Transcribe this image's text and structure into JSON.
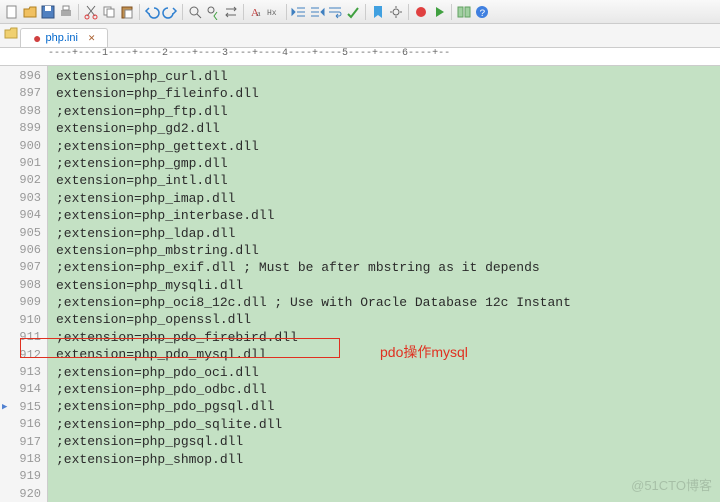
{
  "tab": {
    "filename": "php.ini"
  },
  "ruler_text": "----+----1----+----2----+----3----+----4----+----5----+----6----+--",
  "lines": [
    {
      "num": "896",
      "text": "extension=php_curl.dll"
    },
    {
      "num": "897",
      "text": "extension=php_fileinfo.dll"
    },
    {
      "num": "898",
      "text": ";extension=php_ftp.dll"
    },
    {
      "num": "899",
      "text": "extension=php_gd2.dll"
    },
    {
      "num": "900",
      "text": ";extension=php_gettext.dll"
    },
    {
      "num": "901",
      "text": ";extension=php_gmp.dll"
    },
    {
      "num": "902",
      "text": "extension=php_intl.dll"
    },
    {
      "num": "903",
      "text": ";extension=php_imap.dll"
    },
    {
      "num": "904",
      "text": ";extension=php_interbase.dll"
    },
    {
      "num": "905",
      "text": ";extension=php_ldap.dll"
    },
    {
      "num": "906",
      "text": "extension=php_mbstring.dll"
    },
    {
      "num": "907",
      "text": ";extension=php_exif.dll      ; Must be after mbstring as it depends"
    },
    {
      "num": "908",
      "text": "extension=php_mysqli.dll"
    },
    {
      "num": "909",
      "text": ";extension=php_oci8_12c.dll  ; Use with Oracle Database 12c Instant"
    },
    {
      "num": "910",
      "text": "extension=php_openssl.dll"
    },
    {
      "num": "911",
      "text": ";extension=php_pdo_firebird.dll"
    },
    {
      "num": "912",
      "text": "extension=php_pdo_mysql.dll"
    },
    {
      "num": "913",
      "text": ";extension=php_pdo_oci.dll"
    },
    {
      "num": "914",
      "text": ";extension=php_pdo_odbc.dll"
    },
    {
      "num": "915",
      "text": ";extension=php_pdo_pgsql.dll"
    },
    {
      "num": "916",
      "text": ";extension=php_pdo_sqlite.dll"
    },
    {
      "num": "917",
      "text": ";extension=php_pgsql.dll"
    },
    {
      "num": "918",
      "text": ";extension=php_shmop.dll"
    },
    {
      "num": "919",
      "text": ""
    },
    {
      "num": "920",
      "text": ""
    }
  ],
  "annotation": {
    "label": "pdo操作mysql"
  },
  "watermark": "@51CTO博客",
  "toolbar_icons": [
    "new",
    "open",
    "save",
    "print",
    "cut",
    "copy",
    "paste",
    "undo",
    "redo",
    "find",
    "replace",
    "goto",
    "format",
    "web",
    "color",
    "text",
    "hex",
    "ruler",
    "bookmark",
    "config",
    "macro",
    "compare",
    "help",
    "run"
  ]
}
